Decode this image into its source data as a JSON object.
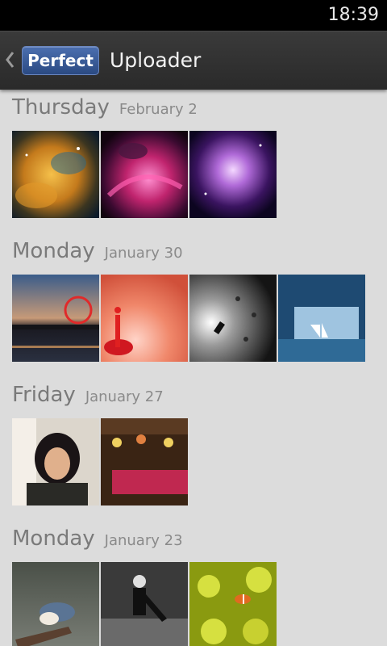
{
  "status_bar": {
    "time": "18:39"
  },
  "action_bar": {
    "back_icon": "chevron-left-icon",
    "logo_text": "Perfect",
    "title": "Uploader"
  },
  "groups": [
    {
      "day": "Thursday",
      "date": "February 2",
      "photos": [
        "nebula-orange-photo",
        "nebula-magenta-photo",
        "orion-nebula-photo"
      ]
    },
    {
      "day": "Monday",
      "date": "January 30",
      "photos": [
        "pier-ferris-wheel-photo",
        "red-water-drop-photo",
        "diver-bw-photo",
        "ice-arch-sailboat-photo"
      ]
    },
    {
      "day": "Friday",
      "date": "January 27",
      "photos": [
        "woman-portrait-photo",
        "shop-front-photo"
      ]
    },
    {
      "day": "Monday",
      "date": "January 23",
      "photos": [
        "nuthatch-bird-photo",
        "dancers-bw-photo",
        "clownfish-anemone-photo"
      ]
    }
  ],
  "colors": {
    "background": "#dcdcdc",
    "action_bar": "#2f2f2f",
    "logo_blue": "#3a5c99",
    "header_text": "#7a7a7a"
  }
}
